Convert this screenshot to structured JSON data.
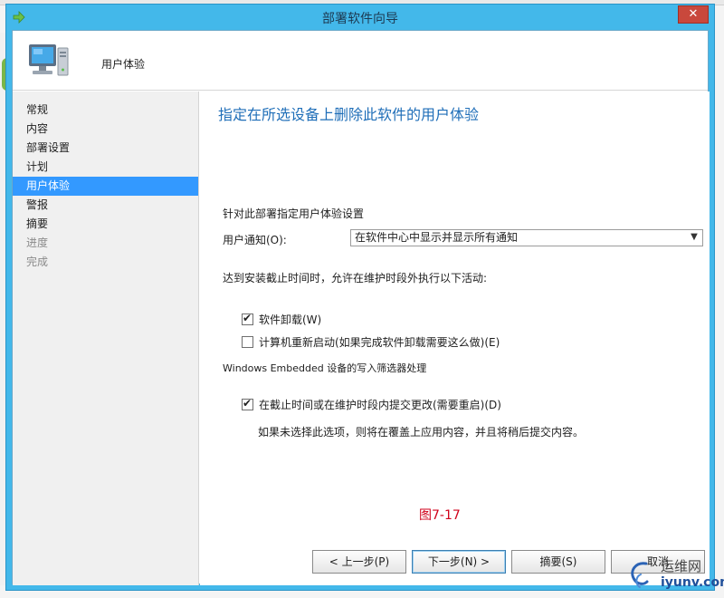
{
  "window": {
    "title": "部署软件向导",
    "close_label": "✕"
  },
  "header": {
    "title": "用户体验"
  },
  "nav": {
    "items": [
      {
        "label": "常规",
        "state": "normal"
      },
      {
        "label": "内容",
        "state": "normal"
      },
      {
        "label": "部署设置",
        "state": "normal"
      },
      {
        "label": "计划",
        "state": "normal"
      },
      {
        "label": "用户体验",
        "state": "selected"
      },
      {
        "label": "警报",
        "state": "normal"
      },
      {
        "label": "摘要",
        "state": "normal"
      },
      {
        "label": "进度",
        "state": "disabled"
      },
      {
        "label": "完成",
        "state": "disabled"
      }
    ]
  },
  "main": {
    "heading": "指定在所选设备上删除此软件的用户体验",
    "section_label": "针对此部署指定用户体验设置",
    "user_notification_label": "用户通知(O):",
    "user_notification_value": "在软件中心中显示并显示所有通知",
    "deadline_text": "达到安装截止时间时，允许在维护时段外执行以下活动:",
    "software_uninstall_label": "软件卸载(W)",
    "software_uninstall_checked": true,
    "restart_label": "计算机重新启动(如果完成软件卸载需要这么做)(E)",
    "restart_checked": false,
    "embedded_title": "Windows Embedded 设备的写入筛选器处理",
    "commit_label": "在截止时间或在维护时段内提交更改(需要重启)(D)",
    "commit_checked": true,
    "commit_note": "如果未选择此选项，则将在覆盖上应用内容，并且将稍后提交内容。",
    "figure_label": "图7-17"
  },
  "footer": {
    "prev_label": "< 上一步(P)",
    "next_label": "下一步(N) >",
    "summary_label": "摘要(S)",
    "cancel_label": "取消"
  },
  "watermark": {
    "line1": "运维网",
    "line2": "iyunv.com"
  },
  "colors": {
    "title_bar": "#43b8ea",
    "heading": "#1f6eb8",
    "selected": "#3399ff",
    "figure_label": "#d0021b"
  }
}
